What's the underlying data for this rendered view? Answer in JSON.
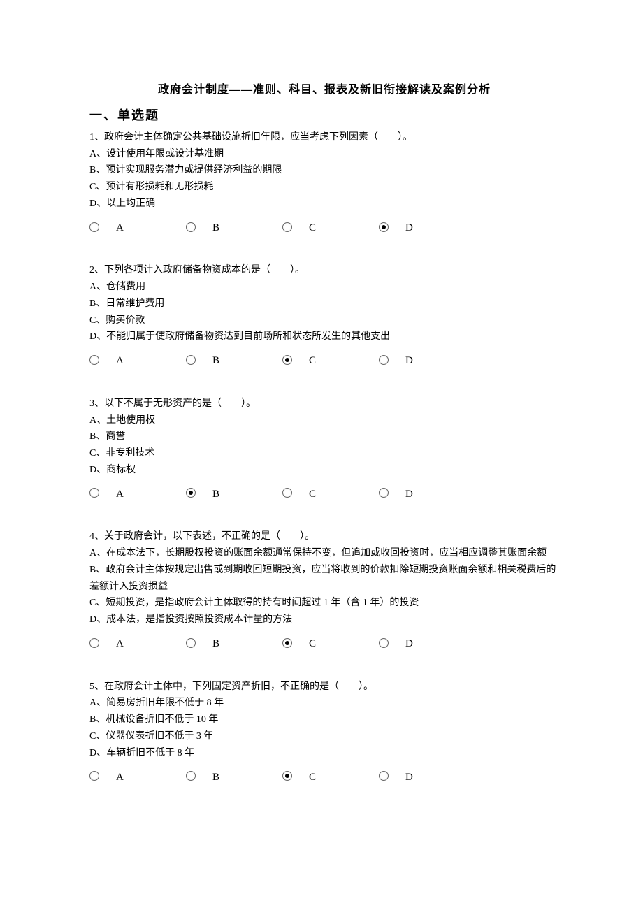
{
  "title": "政府会计制度——准则、科目、报表及新旧衔接解读及案例分析",
  "section_heading": "一、单选题",
  "option_labels": {
    "A": "A",
    "B": "B",
    "C": "C",
    "D": "D"
  },
  "questions": [
    {
      "stem": "1、政府会计主体确定公共基础设施折旧年限，应当考虑下列因素（　　）。",
      "options": [
        "A、设计使用年限或设计基准期",
        "B、预计实现服务潜力或提供经济利益的期限",
        "C、预计有形损耗和无形损耗",
        "D、以上均正确"
      ],
      "selected": "D"
    },
    {
      "stem": "2、下列各项计入政府储备物资成本的是（　　）。",
      "options": [
        "A、仓储费用",
        "B、日常维护费用",
        "C、购买价款",
        "D、不能归属于使政府储备物资达到目前场所和状态所发生的其他支出"
      ],
      "selected": "C"
    },
    {
      "stem": "3、以下不属于无形资产的是（　　）。",
      "options": [
        "A、土地使用权",
        "B、商誉",
        "C、非专利技术",
        "D、商标权"
      ],
      "selected": "B"
    },
    {
      "stem": "4、关于政府会计，以下表述，不正确的是（　　）。",
      "options": [
        "A、在成本法下，长期股权投资的账面余额通常保持不变，但追加或收回投资时，应当相应调整其账面余额",
        "B、政府会计主体按规定出售或到期收回短期投资，应当将收到的价款扣除短期投资账面余额和相关税费后的差额计入投资损益",
        "C、短期投资，是指政府会计主体取得的持有时间超过 1 年（含 1 年）的投资",
        "D、成本法，是指投资按照投资成本计量的方法"
      ],
      "selected": "C"
    },
    {
      "stem": "5、在政府会计主体中，下列固定资产折旧，不正确的是（　　）。",
      "options": [
        "A、简易房折旧年限不低于 8 年",
        "B、机械设备折旧不低于 10 年",
        "C、仪器仪表折旧不低于 3 年",
        "D、车辆折旧不低于 8 年"
      ],
      "selected": "C"
    }
  ]
}
